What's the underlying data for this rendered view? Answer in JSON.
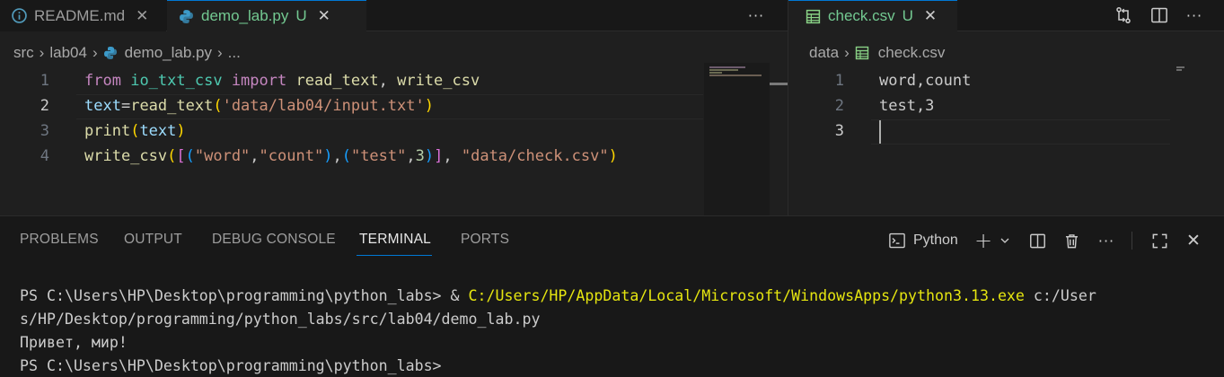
{
  "left_editor": {
    "tabs": [
      {
        "label": "README.md",
        "status": ""
      },
      {
        "label": "demo_lab.py",
        "status": "U"
      }
    ],
    "more": "···",
    "breadcrumb": [
      "src",
      "lab04",
      "demo_lab.py",
      "..."
    ],
    "line_numbers": [
      "1",
      "2",
      "3",
      "4"
    ],
    "lines": [
      [
        [
          "kw",
          "from"
        ],
        [
          "plain",
          " "
        ],
        [
          "mod",
          "io_txt_csv"
        ],
        [
          "plain",
          " "
        ],
        [
          "kw",
          "import"
        ],
        [
          "plain",
          " "
        ],
        [
          "fn",
          "read_text"
        ],
        [
          "plain",
          ", "
        ],
        [
          "fn",
          "write_csv"
        ]
      ],
      [
        [
          "var",
          "text"
        ],
        [
          "plain",
          "="
        ],
        [
          "fn",
          "read_text"
        ],
        [
          "b1",
          "("
        ],
        [
          "str",
          "'data/lab04/input.txt'"
        ],
        [
          "b1",
          ")"
        ]
      ],
      [
        [
          "fn",
          "print"
        ],
        [
          "b1",
          "("
        ],
        [
          "var",
          "text"
        ],
        [
          "b1",
          ")"
        ]
      ],
      [
        [
          "fn",
          "write_csv"
        ],
        [
          "b1",
          "("
        ],
        [
          "b2",
          "["
        ],
        [
          "b3",
          "("
        ],
        [
          "str",
          "\"word\""
        ],
        [
          "plain",
          ","
        ],
        [
          "str",
          "\"count\""
        ],
        [
          "b3",
          ")"
        ],
        [
          "plain",
          ","
        ],
        [
          "b3",
          "("
        ],
        [
          "str",
          "\"test\""
        ],
        [
          "plain",
          ","
        ],
        [
          "num",
          "3"
        ],
        [
          "b3",
          ")"
        ],
        [
          "b2",
          "]"
        ],
        [
          "plain",
          ", "
        ],
        [
          "str",
          "\"data/check.csv\""
        ],
        [
          "b1",
          ")"
        ]
      ]
    ]
  },
  "right_editor": {
    "tab": {
      "label": "check.csv",
      "status": "U"
    },
    "breadcrumb": [
      "data",
      "check.csv"
    ],
    "line_numbers": [
      "1",
      "2",
      "3"
    ],
    "lines": [
      "word,count",
      "test,3",
      ""
    ]
  },
  "panel": {
    "tabs": [
      "PROBLEMS",
      "OUTPUT",
      "DEBUG CONSOLE",
      "TERMINAL",
      "PORTS"
    ],
    "active_tab": "TERMINAL",
    "shell_label": "Python",
    "more": "···",
    "terminal": {
      "line1_prompt": "PS C:\\Users\\HP\\Desktop\\programming\\python_labs> & ",
      "line1_exe": "C:/Users/HP/AppData/Local/Microsoft/WindowsApps/python3.13.exe",
      "line1_arg": " c:/User",
      "line2": "s/HP/Desktop/programming/python_labs/src/lab04/demo_lab.py",
      "line3": "Привет, мир!",
      "line4": "PS C:\\Users\\HP\\Desktop\\programming\\python_labs>"
    }
  },
  "colors": {
    "accent": "#0078d4",
    "untracked": "#73c991",
    "editor_bg": "#1f1f1f",
    "chrome_bg": "#181818"
  }
}
